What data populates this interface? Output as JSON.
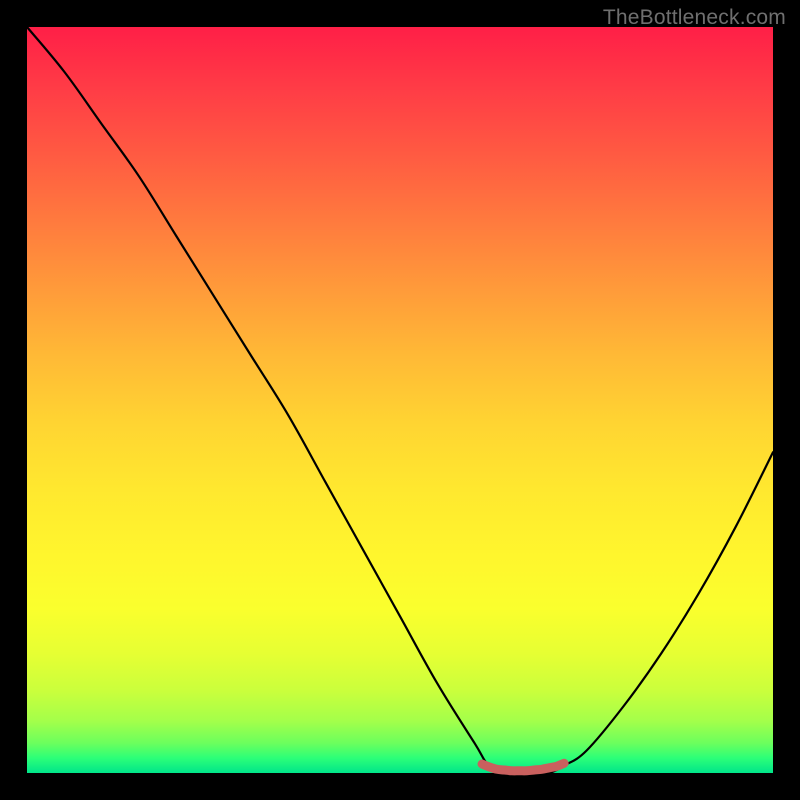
{
  "watermark": "TheBottleneck.com",
  "chart_data": {
    "type": "line",
    "title": "",
    "xlabel": "",
    "ylabel": "",
    "xlim": [
      0,
      100
    ],
    "ylim": [
      0,
      100
    ],
    "grid": false,
    "legend": false,
    "series": [
      {
        "name": "bottleneck-curve",
        "x": [
          0,
          5,
          10,
          15,
          20,
          25,
          30,
          35,
          40,
          45,
          50,
          55,
          60,
          62,
          65,
          68,
          70,
          72,
          75,
          80,
          85,
          90,
          95,
          100
        ],
        "y": [
          100,
          94,
          87,
          80,
          72,
          64,
          56,
          48,
          39,
          30,
          21,
          12,
          4,
          1,
          0,
          0,
          0,
          1,
          3,
          9,
          16,
          24,
          33,
          43
        ]
      },
      {
        "name": "flat-marker",
        "x": [
          61,
          62,
          63,
          64,
          65,
          66,
          67,
          68,
          69,
          70,
          71,
          72
        ],
        "y": [
          1.2,
          0.8,
          0.5,
          0.4,
          0.3,
          0.3,
          0.3,
          0.4,
          0.5,
          0.7,
          0.9,
          1.3
        ]
      }
    ],
    "colors": {
      "curve": "#000000",
      "marker": "#c9605e",
      "gradient_top": "#ff1f47",
      "gradient_bottom": "#00e58a"
    }
  }
}
